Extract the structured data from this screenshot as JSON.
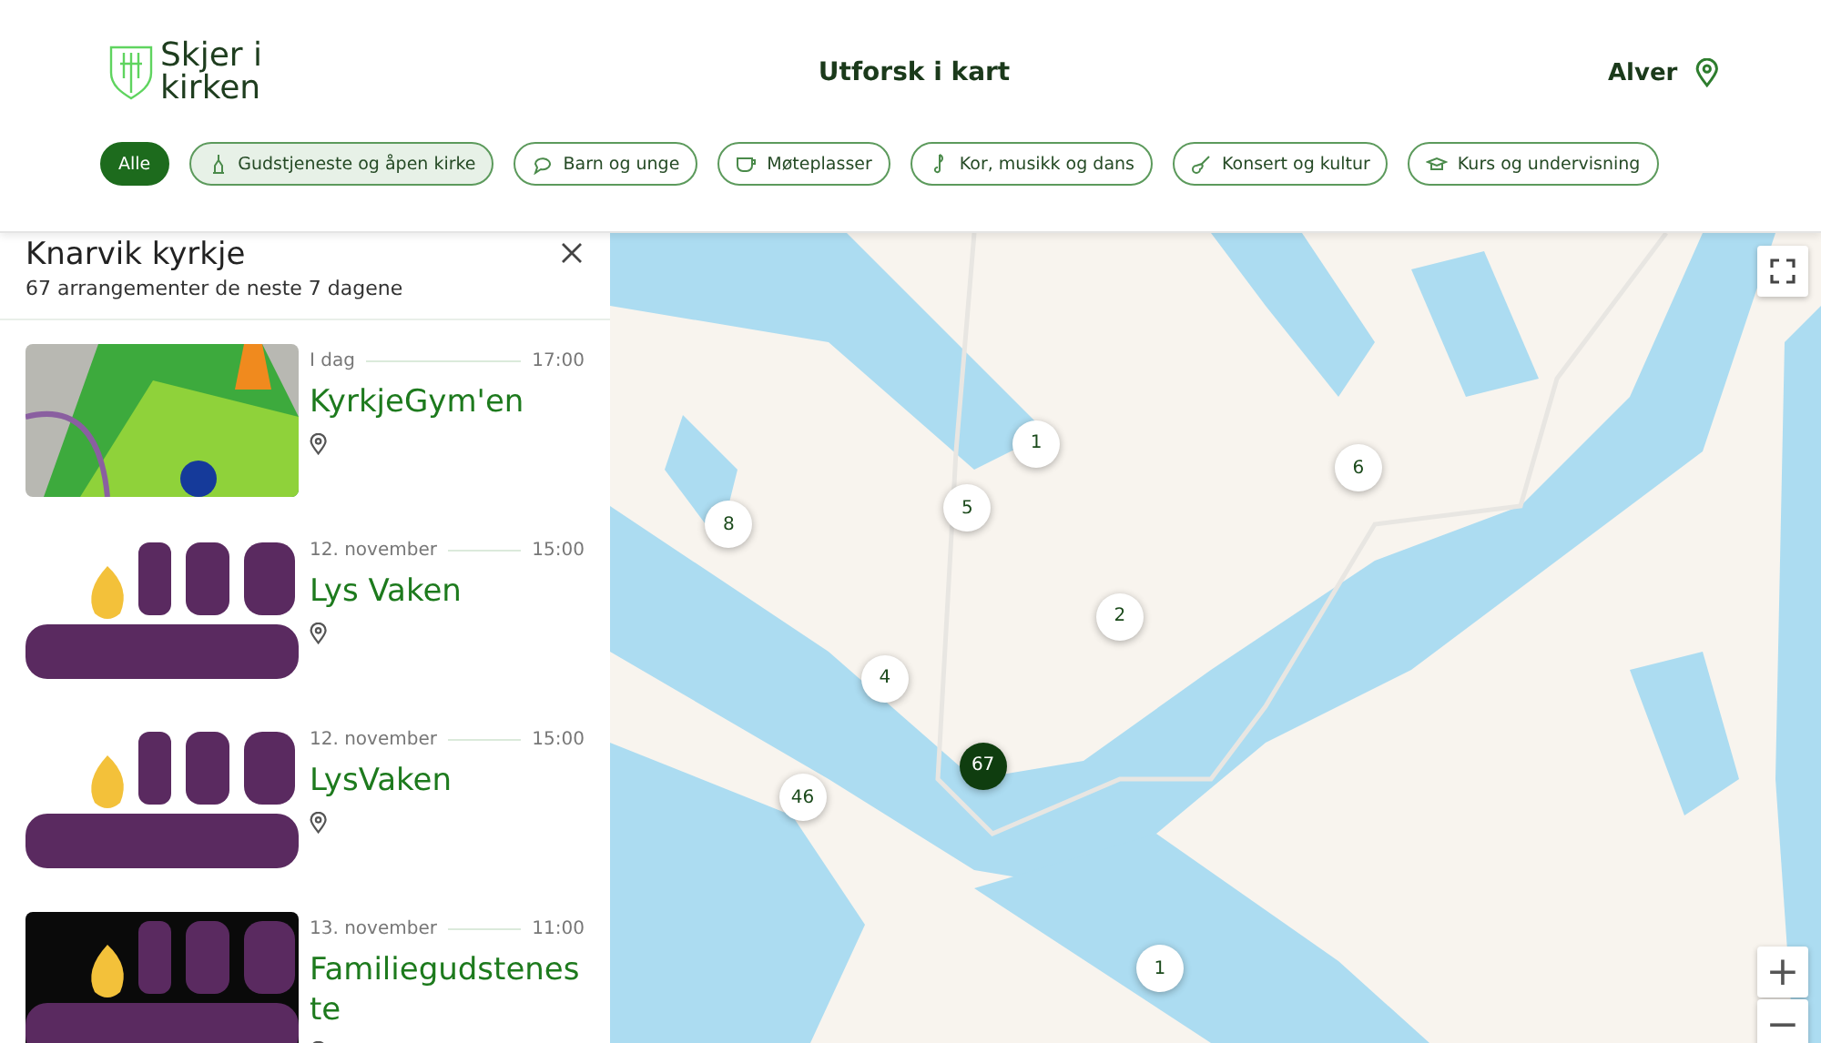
{
  "header": {
    "logo_text": "Skjer i kirken",
    "nav_link": "Utforsk i kart",
    "location": "Alver"
  },
  "filters": [
    {
      "label": "Alle",
      "kind": "all",
      "selected": true
    },
    {
      "label": "Gudstjeneste og åpen kirke",
      "kind": "church",
      "selected": false
    },
    {
      "label": "Barn og unge",
      "kind": "children",
      "selected": false
    },
    {
      "label": "Møteplasser",
      "kind": "cup",
      "selected": false
    },
    {
      "label": "Kor, musikk og dans",
      "kind": "music",
      "selected": false
    },
    {
      "label": "Konsert og kultur",
      "kind": "guitar",
      "selected": false
    },
    {
      "label": "Kurs og undervisning",
      "kind": "school",
      "selected": false
    }
  ],
  "panel": {
    "title": "Knarvik kyrkje",
    "subtitle": "67 arrangementer de neste 7 dagene",
    "events": [
      {
        "date": "I dag",
        "time": "17:00",
        "title": "KyrkjeGym'en"
      },
      {
        "date": "12. november",
        "time": "15:00",
        "title": "Lys Vaken"
      },
      {
        "date": "12. november",
        "time": "15:00",
        "title": "LysVaken"
      },
      {
        "date": "13. november",
        "time": "11:00",
        "title": "Familiegudsteneste"
      }
    ]
  },
  "map": {
    "markers": [
      {
        "count": "1",
        "selected": false
      },
      {
        "count": "5",
        "selected": false
      },
      {
        "count": "8",
        "selected": false
      },
      {
        "count": "6",
        "selected": false
      },
      {
        "count": "2",
        "selected": false
      },
      {
        "count": "4",
        "selected": false
      },
      {
        "count": "67",
        "selected": true
      },
      {
        "count": "46",
        "selected": false
      },
      {
        "count": "1",
        "selected": false
      }
    ],
    "zoom_in": "+",
    "zoom_out": "−"
  }
}
